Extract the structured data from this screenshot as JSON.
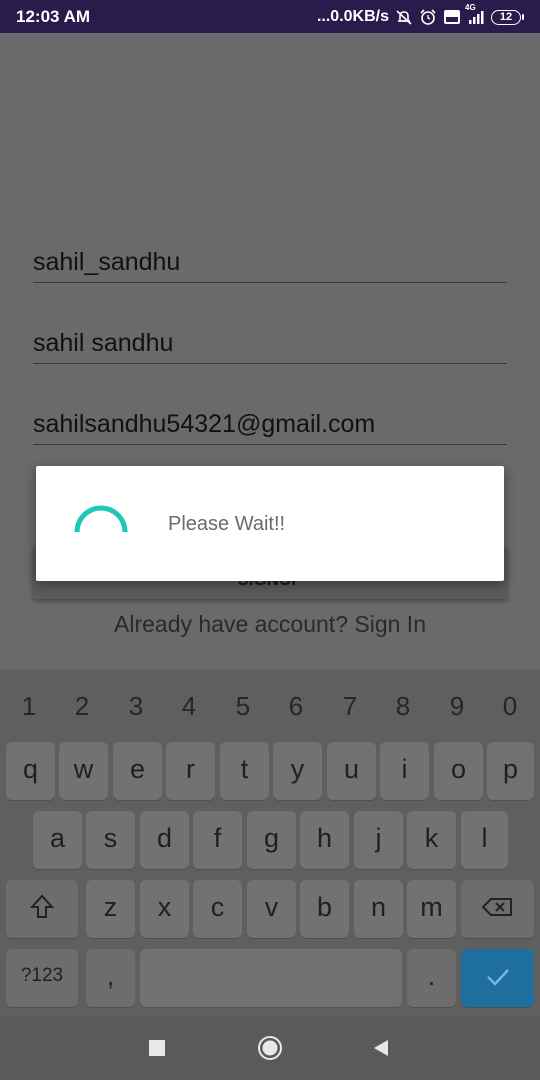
{
  "status_bar": {
    "time": "12:03 AM",
    "speed": "...0.0KB/s",
    "network": "4G",
    "battery": "12"
  },
  "form": {
    "username": "sahil_sandhu",
    "full_name": "sahil sandhu",
    "email": "sahilsandhu54321@gmail.com",
    "password": "",
    "signup_label": "SIGNUP",
    "signin_link": "Already have account? Sign In"
  },
  "dialog": {
    "message": "Please Wait!!",
    "spinner_color": "#1fc7b9"
  },
  "keyboard": {
    "numbers": [
      "1",
      "2",
      "3",
      "4",
      "5",
      "6",
      "7",
      "8",
      "9",
      "0"
    ],
    "row1": [
      "q",
      "w",
      "e",
      "r",
      "t",
      "y",
      "u",
      "i",
      "o",
      "p"
    ],
    "row2": [
      "a",
      "s",
      "d",
      "f",
      "g",
      "h",
      "j",
      "k",
      "l"
    ],
    "row3": [
      "z",
      "x",
      "c",
      "v",
      "b",
      "n",
      "m"
    ],
    "symbols_key": "?123",
    "comma_key": ",",
    "period_key": ".",
    "icons": {
      "shift": "shift-icon",
      "backspace": "backspace-icon",
      "enter": "checkmark-icon"
    }
  },
  "nav_bar": {
    "icons": [
      "recents-square-icon",
      "home-circle-icon",
      "back-triangle-icon"
    ]
  },
  "colors": {
    "status_bar_bg": "#2a1b4d",
    "accent_teal": "#1fc7b9",
    "enter_key": "#1f6f9e"
  }
}
